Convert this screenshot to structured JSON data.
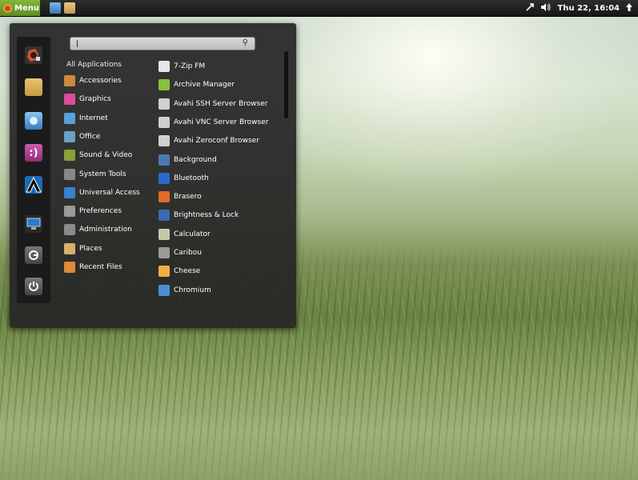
{
  "panel": {
    "menu_label": "Menu",
    "clock": "Thu 22, 16:04",
    "icons": [
      "menu-logo-icon",
      "browser-launcher-icon",
      "files-launcher-icon",
      "network-icon",
      "volume-icon",
      "user-icon"
    ]
  },
  "search": {
    "value": "",
    "placeholder": ""
  },
  "favorites": [
    "app-store-icon",
    "files-icon",
    "browser-icon",
    "chat-icon",
    "terminal-icon",
    "display-icon",
    "logout-icon",
    "power-icon"
  ],
  "categories_header": "All Applications",
  "categories": [
    {
      "label": "Accessories",
      "icon": "accessories-icon",
      "color": "#c98a3a"
    },
    {
      "label": "Graphics",
      "icon": "graphics-icon",
      "color": "#e04a9a"
    },
    {
      "label": "Internet",
      "icon": "internet-icon",
      "color": "#5aa0d8"
    },
    {
      "label": "Office",
      "icon": "office-icon",
      "color": "#6aa0c8"
    },
    {
      "label": "Sound & Video",
      "icon": "sound-video-icon",
      "color": "#8aa03a"
    },
    {
      "label": "System Tools",
      "icon": "system-tools-icon",
      "color": "#888888"
    },
    {
      "label": "Universal Access",
      "icon": "universal-access-icon",
      "color": "#3a7fd0"
    },
    {
      "label": "Preferences",
      "icon": "preferences-icon",
      "color": "#9a9a9a"
    },
    {
      "label": "Administration",
      "icon": "administration-icon",
      "color": "#8a8a8a"
    },
    {
      "label": "Places",
      "icon": "places-icon",
      "color": "#d8b06a"
    },
    {
      "label": "Recent Files",
      "icon": "recent-files-icon",
      "color": "#e08a3a"
    }
  ],
  "apps": [
    {
      "label": "7-Zip FM",
      "icon": "7zip-icon",
      "color": "#e6e6e6"
    },
    {
      "label": "Archive Manager",
      "icon": "archive-icon",
      "color": "#8ac23a"
    },
    {
      "label": "Avahi SSH Server Browser",
      "icon": "avahi-ssh-icon",
      "color": "#d0d0d0"
    },
    {
      "label": "Avahi VNC Server Browser",
      "icon": "avahi-vnc-icon",
      "color": "#d0d0d0"
    },
    {
      "label": "Avahi Zeroconf Browser",
      "icon": "avahi-zeroconf-icon",
      "color": "#d0d0d0"
    },
    {
      "label": "Background",
      "icon": "background-icon",
      "color": "#4a7ab0"
    },
    {
      "label": "Bluetooth",
      "icon": "bluetooth-icon",
      "color": "#2a6ad0"
    },
    {
      "label": "Brasero",
      "icon": "brasero-icon",
      "color": "#e06a2a"
    },
    {
      "label": "Brightness & Lock",
      "icon": "brightness-icon",
      "color": "#3a6ab0"
    },
    {
      "label": "Calculator",
      "icon": "calculator-icon",
      "color": "#c8c8a8"
    },
    {
      "label": "Caribou",
      "icon": "caribou-icon",
      "color": "#9a9a9a"
    },
    {
      "label": "Cheese",
      "icon": "cheese-icon",
      "color": "#f0b040"
    },
    {
      "label": "Chromium",
      "icon": "chromium-icon",
      "color": "#4a90d0"
    }
  ]
}
